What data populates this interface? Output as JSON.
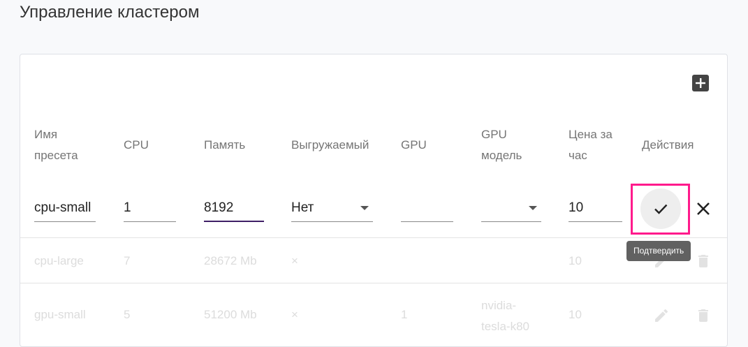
{
  "page": {
    "title": "Управление кластером"
  },
  "table": {
    "headers": {
      "name": "Имя\nпресета",
      "cpu": "CPU",
      "memory": "Память",
      "preemptible": "Выгружаемый",
      "gpu": "GPU",
      "gpu_model": "GPU\nмодель",
      "price": "Цена за\nчас",
      "actions": "Действия"
    },
    "edit_row": {
      "name": "cpu-small",
      "cpu": "1",
      "memory": "8192",
      "preemptible": "Нет",
      "gpu": "",
      "gpu_model": "",
      "price": "10"
    },
    "rows": [
      {
        "name": "cpu-large",
        "cpu": "7",
        "memory": "28672 Mb",
        "preemptible": "×",
        "gpu": "",
        "gpu_model": "",
        "price": "10"
      },
      {
        "name": "gpu-small",
        "cpu": "5",
        "memory": "51200 Mb",
        "preemptible": "×",
        "gpu": "1",
        "gpu_model": "nvidia-\ntesla-k80",
        "price": "10"
      }
    ]
  },
  "tooltip": {
    "confirm": "Подтвердить"
  },
  "icons": {
    "add": "add-box-icon",
    "confirm": "check-icon",
    "cancel": "close-icon",
    "edit": "pencil-icon",
    "delete": "trash-icon"
  },
  "colors": {
    "highlight": "#ff1a8c",
    "focus_underline": "#3f1f66",
    "tooltip_bg": "#616161",
    "muted_text": "#dcdcdc"
  }
}
